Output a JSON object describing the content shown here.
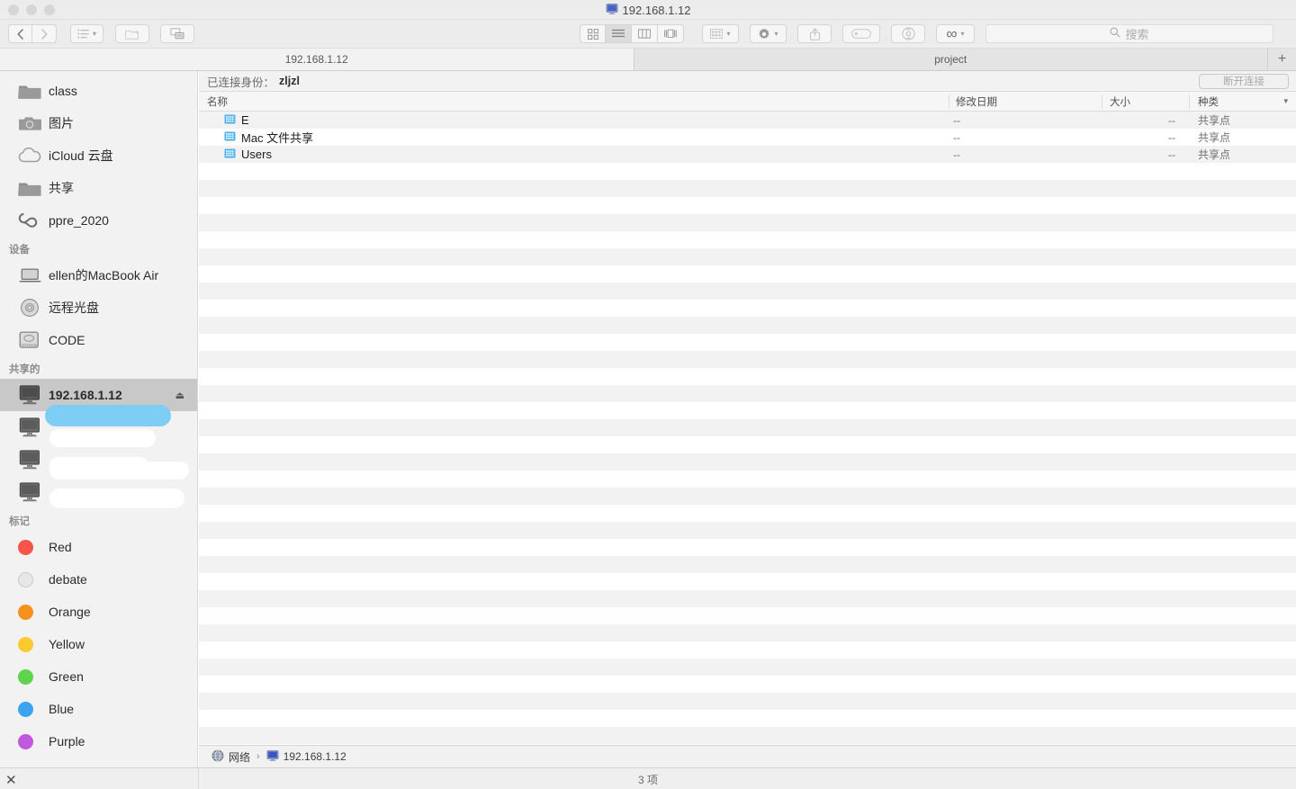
{
  "window": {
    "title": "192.168.1.12",
    "title_icon": "server-monitor-icon",
    "traffic_lights": [
      "close",
      "minimize",
      "zoom"
    ]
  },
  "toolbar": {
    "back_label": "‹",
    "forward_label": "›",
    "arrange_label": "arrange-icon",
    "new_folder_label": "new-folder-icon",
    "share_screen_label": "screen-share-icon",
    "view_icon_label": "icon-view",
    "view_list_label": "list-view",
    "view_column_label": "column-view",
    "view_gallery_label": "gallery-view",
    "group_label": "group-icon",
    "action_label": "gear-icon",
    "share_label": "share-icon",
    "tag_label": "tag-icon",
    "airdrop_label": "airdrop-icon",
    "dropbox_label": "∞",
    "chevron": "⌄"
  },
  "search": {
    "placeholder": "搜索",
    "value": ""
  },
  "tabs": {
    "items": [
      {
        "label": "192.168.1.12",
        "active": true
      },
      {
        "label": "project",
        "active": false
      }
    ],
    "add_label": "+"
  },
  "sidebar": {
    "groups": [
      {
        "title": "",
        "items": [
          {
            "label": "class",
            "icon": "folder-icon"
          },
          {
            "label": "图片",
            "icon": "camera-icon"
          },
          {
            "label": "iCloud 云盘",
            "icon": "cloud-icon"
          },
          {
            "label": "共享",
            "icon": "folder-icon"
          },
          {
            "label": "ppre_2020",
            "icon": "infinity-icon"
          }
        ]
      },
      {
        "title": "设备",
        "items": [
          {
            "label": "ellen的MacBook Air",
            "icon": "laptop-icon"
          },
          {
            "label": "远程光盘",
            "icon": "disc-icon"
          },
          {
            "label": "CODE",
            "icon": "hard-drive-icon"
          }
        ]
      },
      {
        "title": "共享的",
        "items": [
          {
            "label": "192.168.1.12",
            "icon": "server-monitor-icon",
            "selected": true,
            "eject": "⏏"
          },
          {
            "label": "",
            "icon": "server-monitor-icon",
            "redacted": true
          },
          {
            "label": "",
            "icon": "server-monitor-icon",
            "redacted": true
          },
          {
            "label": "",
            "icon": "server-monitor-icon",
            "redacted": true
          }
        ]
      },
      {
        "title": "标记",
        "items": [
          {
            "label": "Red",
            "icon": "tag-dot",
            "color": "#f9544b"
          },
          {
            "label": "debate",
            "icon": "tag-dot",
            "color": "#e4e4e4"
          },
          {
            "label": "Orange",
            "icon": "tag-dot",
            "color": "#f5911e"
          },
          {
            "label": "Yellow",
            "icon": "tag-dot",
            "color": "#fcc931"
          },
          {
            "label": "Green",
            "icon": "tag-dot",
            "color": "#5fd34d"
          },
          {
            "label": "Blue",
            "icon": "tag-dot",
            "color": "#3aa4f0"
          },
          {
            "label": "Purple",
            "icon": "tag-dot",
            "color": "#c159dd"
          }
        ]
      }
    ]
  },
  "connection": {
    "label": "已连接身份：",
    "user": "zljzl",
    "disconnect_label": "断开连接"
  },
  "file_list": {
    "columns": [
      {
        "key": "name",
        "label": "名称"
      },
      {
        "key": "date",
        "label": "修改日期"
      },
      {
        "key": "size",
        "label": "大小"
      },
      {
        "key": "kind",
        "label": "种类"
      }
    ],
    "rows": [
      {
        "name": "E",
        "date": "--",
        "size": "--",
        "kind": "共享点",
        "icon": "share-point-icon"
      },
      {
        "name": "Mac 文件共享",
        "date": "--",
        "size": "--",
        "kind": "共享点",
        "icon": "share-point-icon"
      },
      {
        "name": "Users",
        "date": "--",
        "size": "--",
        "kind": "共享点",
        "icon": "share-point-icon"
      }
    ],
    "empty_row_count": 36
  },
  "path_bar": {
    "items": [
      {
        "label": "网络",
        "icon": "globe-icon"
      },
      {
        "label": "192.168.1.12",
        "icon": "server-monitor-icon"
      }
    ],
    "separator": "›"
  },
  "status_bar": {
    "close_label": "✕",
    "count_label": "3 项"
  },
  "colors": {
    "accent_blue": "#3aa4f0",
    "selection_gray": "#c8c8c8",
    "stripe": "#f2f2f2",
    "chrome": "#ececec"
  }
}
